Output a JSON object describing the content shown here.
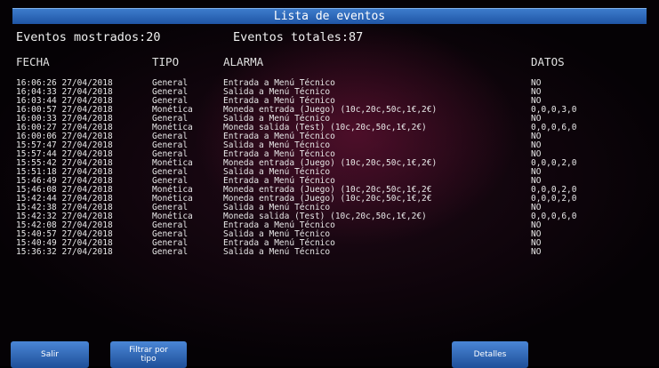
{
  "title": "Lista de eventos",
  "counts": {
    "shown": "Eventos mostrados:20",
    "total": "Eventos totales:87"
  },
  "columns": {
    "fecha": "FECHA",
    "tipo": "TIPO",
    "alarma": "ALARMA",
    "datos": "DATOS"
  },
  "rows": [
    {
      "fecha": "16:06:26 27/04/2018",
      "tipo": "General",
      "alarma": "Entrada a Menú Técnico",
      "datos": "NO"
    },
    {
      "fecha": "16;04:33 27/04/2018",
      "tipo": "General",
      "alarma": "Salida a Menú Técnico",
      "datos": "NO"
    },
    {
      "fecha": "16:03:44 27/04/2018",
      "tipo": "General",
      "alarma": "Entrada a Menú Técnico",
      "datos": "NO"
    },
    {
      "fecha": "16:00:57 27/04/2018",
      "tipo": "Monética",
      "alarma": "Moneda entrada (Juego) (10c,20c,50c,1€,2€)",
      "datos": "0,0,0,3,0"
    },
    {
      "fecha": "16:00:33 27/04/2018",
      "tipo": "General",
      "alarma": "Salida a Menú Técnico",
      "datos": "NO"
    },
    {
      "fecha": "16:00:27 27/04/2018",
      "tipo": "Monética",
      "alarma": "Moneda salida (Test) (10c,20c,50c,1€,2€)",
      "datos": "0,0,0,6,0"
    },
    {
      "fecha": "16:00:06 27/04/2018",
      "tipo": "General",
      "alarma": "Entrada a Menú Técnico",
      "datos": "NO"
    },
    {
      "fecha": "15:57:47 27/04/2018",
      "tipo": "General",
      "alarma": "Salida a Menú Técnico",
      "datos": "NO"
    },
    {
      "fecha": "15:57:44 27/04/2018",
      "tipo": "General",
      "alarma": "Entrada a Menú Técnico",
      "datos": "NO"
    },
    {
      "fecha": "15:55:42 27/04/2018",
      "tipo": "Monética",
      "alarma": "Moneda entrada (Juego) (10c,20c,50c,1€,2€)",
      "datos": "0,0,0,2,0"
    },
    {
      "fecha": "15:51:18 27/04/2018",
      "tipo": "General",
      "alarma": "Salida a Menú Técnico",
      "datos": "NO"
    },
    {
      "fecha": "15:46:49 27/04/2018",
      "tipo": "General",
      "alarma": "Entrada a Menú Técnico",
      "datos": "NO"
    },
    {
      "fecha": "15;46:08 27/04/2018",
      "tipo": "Monética",
      "alarma": "Moneda entrada (Juego) (10c,20c,50c,1€,2€",
      "datos": "0,0,0,2,0"
    },
    {
      "fecha": "15:42:44 27/04/2018",
      "tipo": "Monética",
      "alarma": "Moneda entrada (Juego) (10c,20c,50c,1€,2€",
      "datos": "0,0,0,2,0"
    },
    {
      "fecha": "15:42:38 27/04/2018",
      "tipo": "General",
      "alarma": "Salida a Menú Técnico",
      "datos": "NO"
    },
    {
      "fecha": "15:42:32 27/04/2018",
      "tipo": "Monética",
      "alarma": "Moneda salida (Test) (10c,20c,50c,1€,2€)",
      "datos": "0,0,0,6,0"
    },
    {
      "fecha": "15:42:08 27/04/2018",
      "tipo": "General",
      "alarma": "Entrada a Menú Técnico",
      "datos": "NO"
    },
    {
      "fecha": "15:40:57 27/04/2018",
      "tipo": "General",
      "alarma": "Salida a Menú Técnico",
      "datos": "NO"
    },
    {
      "fecha": "15:40:49 27/04/2018",
      "tipo": "General",
      "alarma": "Entrada a Menú Técnico",
      "datos": "NO"
    },
    {
      "fecha": "15:36:32 27/04/2018",
      "tipo": "General",
      "alarma": "Salida a Menú Técnico",
      "datos": "NO"
    }
  ],
  "buttons": {
    "salir": "Salir",
    "filtrar_line1": "Filtrar por",
    "filtrar_line2": "tipo",
    "detalles": "Detalles"
  }
}
